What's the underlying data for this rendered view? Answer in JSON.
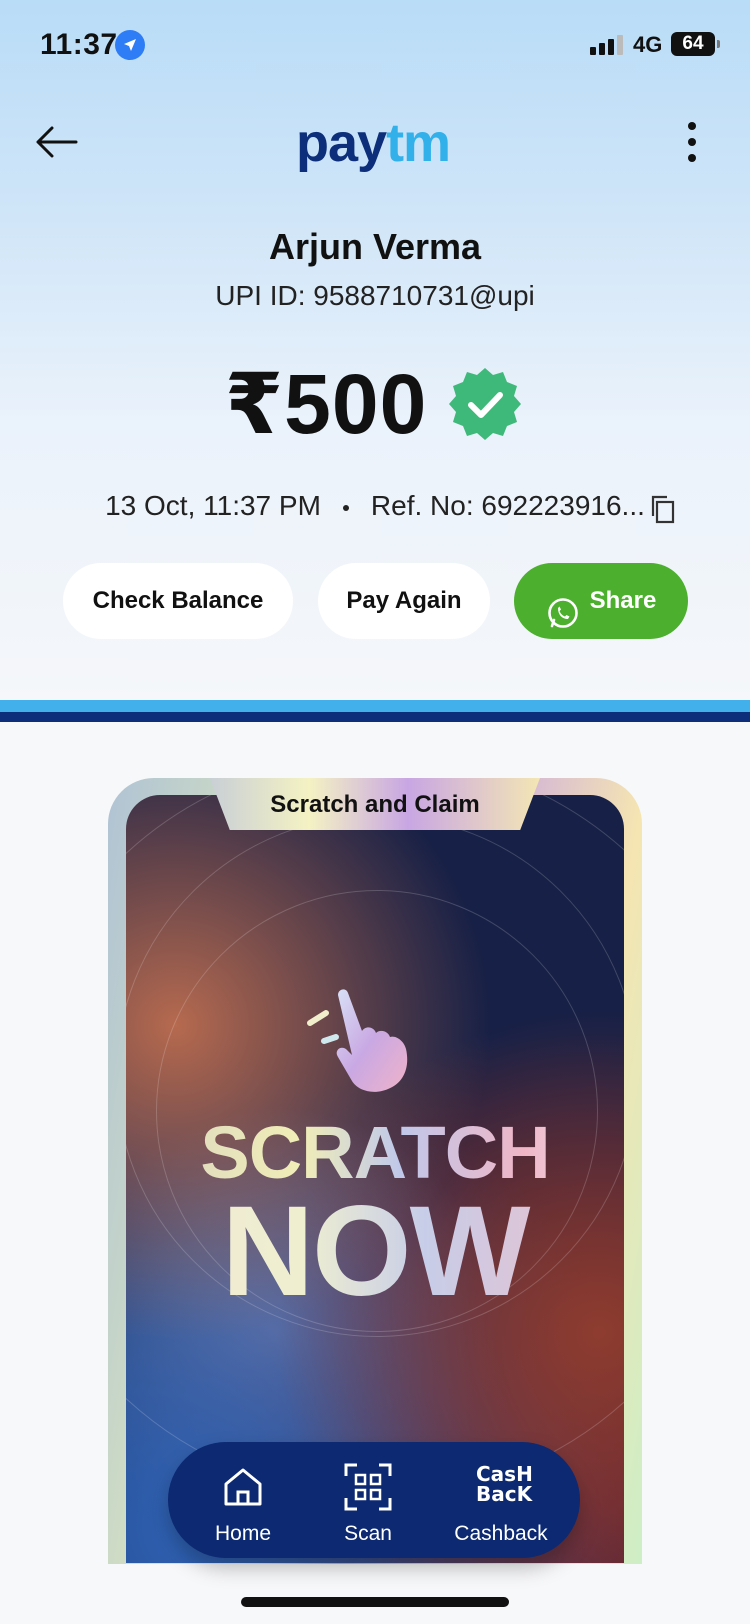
{
  "status_bar": {
    "time": "11:37",
    "network": "4G",
    "battery": "64"
  },
  "header": {
    "logo_part1": "pay",
    "logo_part2": "tm"
  },
  "payee": {
    "name": "Arjun Verma",
    "upi_id": "UPI ID: 9588710731@upi"
  },
  "payment": {
    "amount": "₹500",
    "datetime": "13 Oct, 11:37 PM",
    "ref": "Ref. No: 692223916..."
  },
  "actions": {
    "check_balance": "Check Balance",
    "pay_again": "Pay Again",
    "share": "Share"
  },
  "reward": {
    "tab_label": "Scratch and Claim",
    "line1": "SCRATCH",
    "line2": "NOW"
  },
  "bottom_nav": {
    "items": [
      {
        "label": "Home",
        "icon": "home-icon"
      },
      {
        "label": "Scan",
        "icon": "scan-icon"
      },
      {
        "label": "Cashback",
        "icon": "cashback-icon",
        "icon_text1": "CasH",
        "icon_text2": "BacK"
      }
    ]
  },
  "colors": {
    "brand_dark": "#0d2e7a",
    "brand_light": "#32b0ea",
    "share_green": "#4caf2e",
    "success_green": "#3fb97a"
  }
}
